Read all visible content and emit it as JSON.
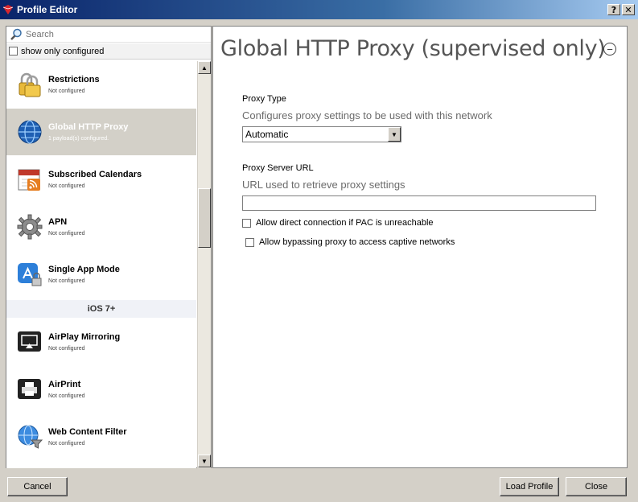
{
  "window": {
    "title": "Profile Editor",
    "help_glyph": "?",
    "close_glyph": "✕"
  },
  "sidebar": {
    "search_placeholder": "Search",
    "filter_label": "show only configured",
    "items": [
      {
        "name": "Restrictions",
        "status": "Not configured",
        "icon": "lock-icon"
      },
      {
        "name": "Global HTTP Proxy",
        "status": "1 payload(s) configured.",
        "icon": "globe-icon"
      },
      {
        "name": "Subscribed Calendars",
        "status": "Not configured",
        "icon": "calendar-icon"
      },
      {
        "name": "APN",
        "status": "Not configured",
        "icon": "gear-icon"
      },
      {
        "name": "Single App Mode",
        "status": "Not configured",
        "icon": "app-store-lock-icon"
      },
      {
        "name": "AirPlay Mirroring",
        "status": "Not configured",
        "icon": "airplay-icon"
      },
      {
        "name": "AirPrint",
        "status": "Not configured",
        "icon": "printer-icon"
      },
      {
        "name": "Web Content Filter",
        "status": "Not configured",
        "icon": "globe-filter-icon"
      }
    ],
    "section_header": "iOS 7+"
  },
  "main": {
    "title": "Global HTTP Proxy (supervised only)",
    "collapse_glyph": "−",
    "proxy_type": {
      "label": "Proxy Type",
      "description": "Configures proxy settings to be used with this network",
      "value": "Automatic"
    },
    "proxy_url": {
      "label": "Proxy Server URL",
      "description": "URL used to retrieve proxy settings",
      "value": ""
    },
    "checkboxes": [
      {
        "label": "Allow direct connection if PAC is unreachable",
        "checked": false
      },
      {
        "label": "Allow bypassing proxy to access captive networks",
        "checked": false
      }
    ]
  },
  "footer": {
    "cancel": "Cancel",
    "load": "Load Profile",
    "close": "Close"
  },
  "colors": {
    "selected_row": "#d3d0c8",
    "titlebar": "#0a246a",
    "window_bg": "#d4d0c8"
  }
}
